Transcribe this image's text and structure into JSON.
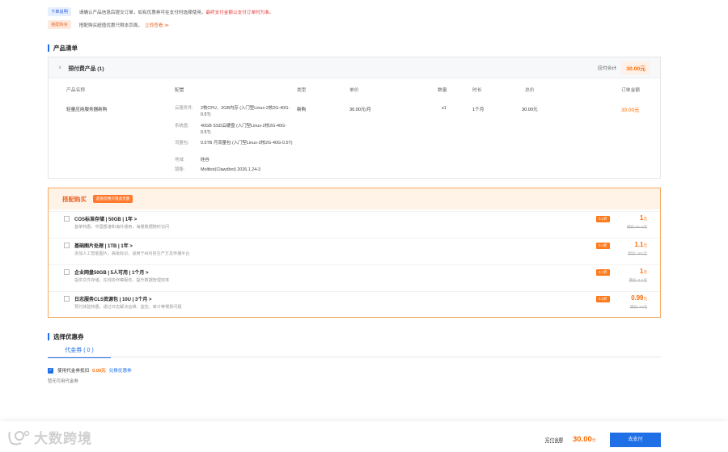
{
  "notices": [
    {
      "tag": "下单说明",
      "text": "请确认产品信息后提交订单，如有优惠券可在支付时选择使用，",
      "highlight": "最终支付金额以支付订单时为准。"
    },
    {
      "tag": "搭配购买",
      "text": "搭配购买超值优惠只限本页面，",
      "link": "立即查看 ≫"
    }
  ],
  "product_section": {
    "title": "产品清单",
    "group_label": "预付费产品 (1)",
    "total_label": "应付合计",
    "total_value": "30.00元",
    "columns": [
      "产品名称",
      "配置",
      "类型",
      "单价",
      "数量",
      "时长",
      "总价",
      "订单金额"
    ],
    "row": {
      "name": "轻量应用服务器新购",
      "config": [
        {
          "key": "云服务件:",
          "value": "2核CPU、2GB内存 (入门型Linux-2核2G-40G-0.5T)"
        },
        {
          "key": "系统盘:",
          "value": "40GB SSD云硬盘 (入门型Linux-2核2G-40G-0.5T)"
        },
        {
          "key": "流量包:",
          "value": "0.5TB 月流量包 (入门型Linux-2核2G-40G-0.5T)"
        },
        {
          "key": "地域:",
          "value": "硅谷"
        },
        {
          "key": "镜像:",
          "value": "Moltbot(Clawdbot) 2026.1.24-3"
        }
      ],
      "type": "新购",
      "unit_price": "30.00元/月",
      "quantity": "x1",
      "duration": "1个月",
      "total": "30.00元",
      "order_amount": "30.00元"
    }
  },
  "bundle": {
    "title": "搭配购买",
    "pill": "超值优惠只限此页面",
    "items": [
      {
        "name": "COS标准存储 | 50GB | 1年 >",
        "desc": "首单特惠，中国香港和海外通用，海量数据随时访问",
        "discount": "0.1折",
        "price": "1",
        "unit": "元",
        "original": "原价 81.6元"
      },
      {
        "name": "基础图片处理 | 1TB | 1年 >",
        "desc": "添加人工智能图片，高级标识，适用于AI内容生产方及传播平台",
        "discount": "0.4折",
        "price": "1.1",
        "unit": "元",
        "original": "原价 282元"
      },
      {
        "name": "企业网盘50GB | 5人可用 | 1个月 >",
        "desc": "提供文件存储，在线协作等服务，提升数据管理效率",
        "discount": "3.1折",
        "price": "1",
        "unit": "元",
        "original": "原价 3.2元"
      },
      {
        "name": "日志服务CLS资源包 | 10U | 3个月 >",
        "desc": "预付体验特惠，通过日志解决运维、监控、审计等場景问题",
        "discount": "0.3折",
        "price": "0.99",
        "unit": "元",
        "original": "原价 32元"
      }
    ]
  },
  "coupon_section": {
    "title": "选择优惠券",
    "tab_label": "代金券 ( 0 )",
    "use_label": "使用代金券抵扣",
    "use_amount": "0.00元",
    "exchange_link": "兑换优惠券",
    "empty_text": "暂无可用代金券"
  },
  "footer": {
    "pay_label": "实付金额",
    "pay_amount": "30.00",
    "pay_unit": "元",
    "pay_button": "去支付"
  },
  "watermark": "大数跨境"
}
